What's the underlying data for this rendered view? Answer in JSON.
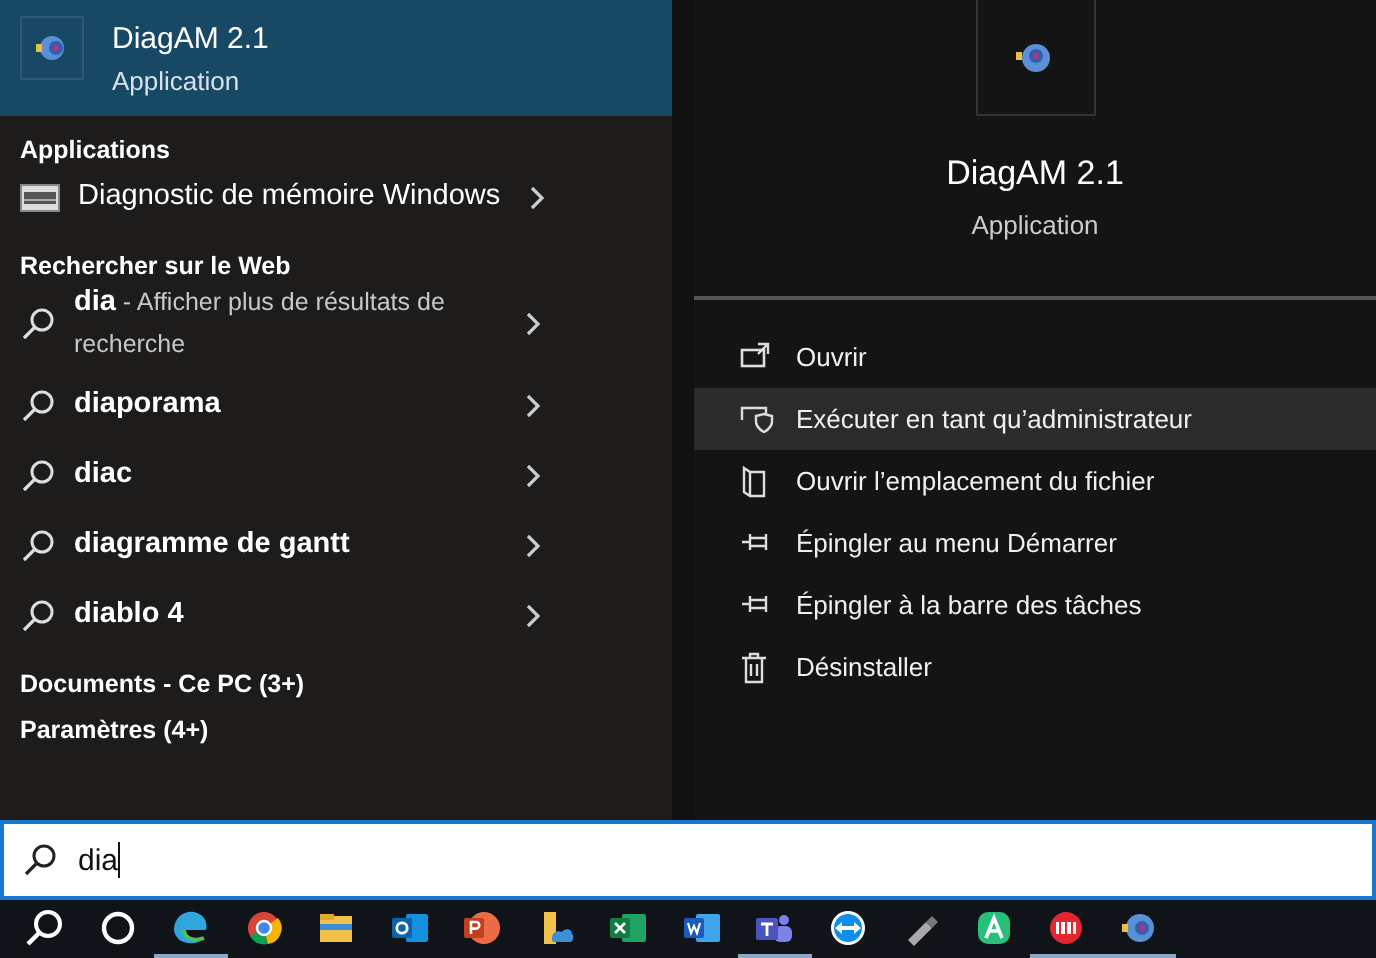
{
  "best_match": {
    "title": "DiagAM 2.1",
    "subtitle": "Application",
    "selected": true
  },
  "sections": [
    {
      "heading": "Applications",
      "items": [
        {
          "kind": "app",
          "text": "Diagnostic de mémoire Windows"
        }
      ]
    },
    {
      "heading": "Rechercher sur le Web",
      "items": [
        {
          "kind": "web",
          "text": "dia",
          "hint": "- Afficher plus de résultats de recherche"
        },
        {
          "kind": "web",
          "text": "diaporama"
        },
        {
          "kind": "web",
          "text": "diac"
        },
        {
          "kind": "web",
          "text": "diagramme de gantt"
        },
        {
          "kind": "web",
          "text": "diablo 4"
        }
      ]
    },
    {
      "heading": "Documents - Ce PC (3+)"
    },
    {
      "heading": "Paramètres (4+)"
    }
  ],
  "preview": {
    "title": "DiagAM 2.1",
    "subtitle": "Application"
  },
  "actions": [
    {
      "kind": "open",
      "label": "Ouvrir",
      "selected": false
    },
    {
      "kind": "admin",
      "label": "Exécuter en tant qu’administrateur",
      "selected": true
    },
    {
      "kind": "folder",
      "label": "Ouvrir l’emplacement du fichier",
      "selected": false
    },
    {
      "kind": "pin",
      "label": "Épingler au menu Démarrer",
      "selected": false
    },
    {
      "kind": "pin",
      "label": "Épingler à la barre des tâches",
      "selected": false
    },
    {
      "kind": "trash",
      "label": "Désinstaller",
      "selected": false
    }
  ],
  "search": {
    "value": "dia"
  },
  "taskbar": [
    {
      "kind": "search",
      "running": false
    },
    {
      "kind": "cortana",
      "running": false
    },
    {
      "kind": "edge",
      "running": true
    },
    {
      "kind": "chrome",
      "running": false
    },
    {
      "kind": "explorer",
      "running": false
    },
    {
      "kind": "outlook",
      "running": false
    },
    {
      "kind": "powerpoint",
      "running": false
    },
    {
      "kind": "onedrive",
      "running": false
    },
    {
      "kind": "excel",
      "running": false
    },
    {
      "kind": "word",
      "running": false
    },
    {
      "kind": "teams",
      "running": true
    },
    {
      "kind": "teamviewer",
      "running": false
    },
    {
      "kind": "usb",
      "running": false
    },
    {
      "kind": "green",
      "running": false
    },
    {
      "kind": "red",
      "running": true
    },
    {
      "kind": "diagam",
      "running": true
    }
  ]
}
